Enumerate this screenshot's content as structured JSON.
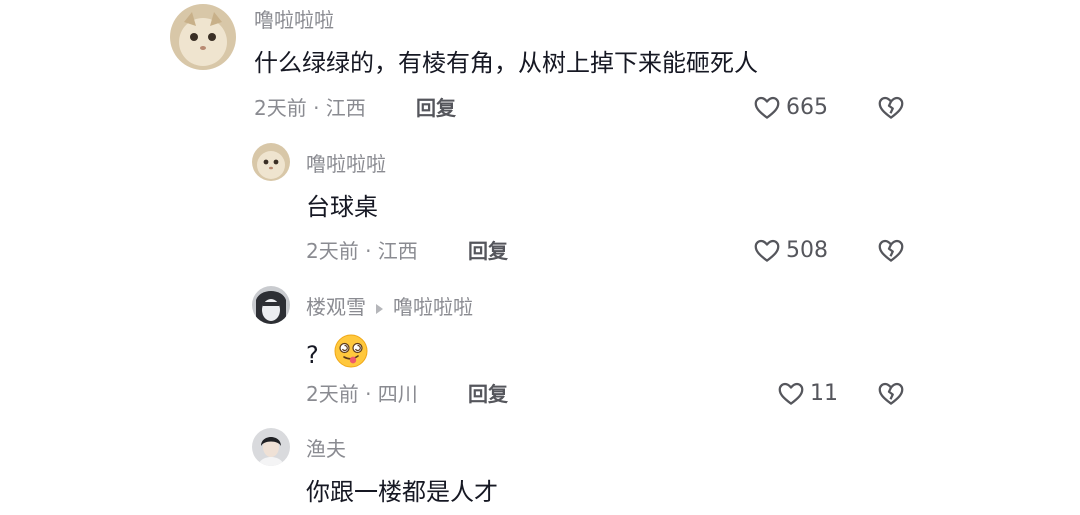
{
  "comments": [
    {
      "username": "噜啦啦啦",
      "text": "什么绿绿的，有棱有角，从树上掉下来能砸死人",
      "time_location": "2天前 · 江西",
      "reply_label": "回复",
      "likes": "665"
    },
    {
      "username": "噜啦啦啦",
      "text": "台球桌",
      "time_location": "2天前 · 江西",
      "reply_label": "回复",
      "likes": "508"
    },
    {
      "username": "楼观雪",
      "reply_to": "噜啦啦啦",
      "text": "?",
      "time_location": "2天前 · 四川",
      "reply_label": "回复",
      "likes": "11"
    },
    {
      "username": "渔夫",
      "text": "你跟一楼都是人才"
    }
  ],
  "icons": {
    "like": "heart-outline-icon",
    "dislike": "broken-heart-icon",
    "emoji": "dizzy-tongue-face-emoji"
  },
  "colors": {
    "meta": "#8a8b91",
    "text": "#161823",
    "emoji": "#ffc83d"
  }
}
